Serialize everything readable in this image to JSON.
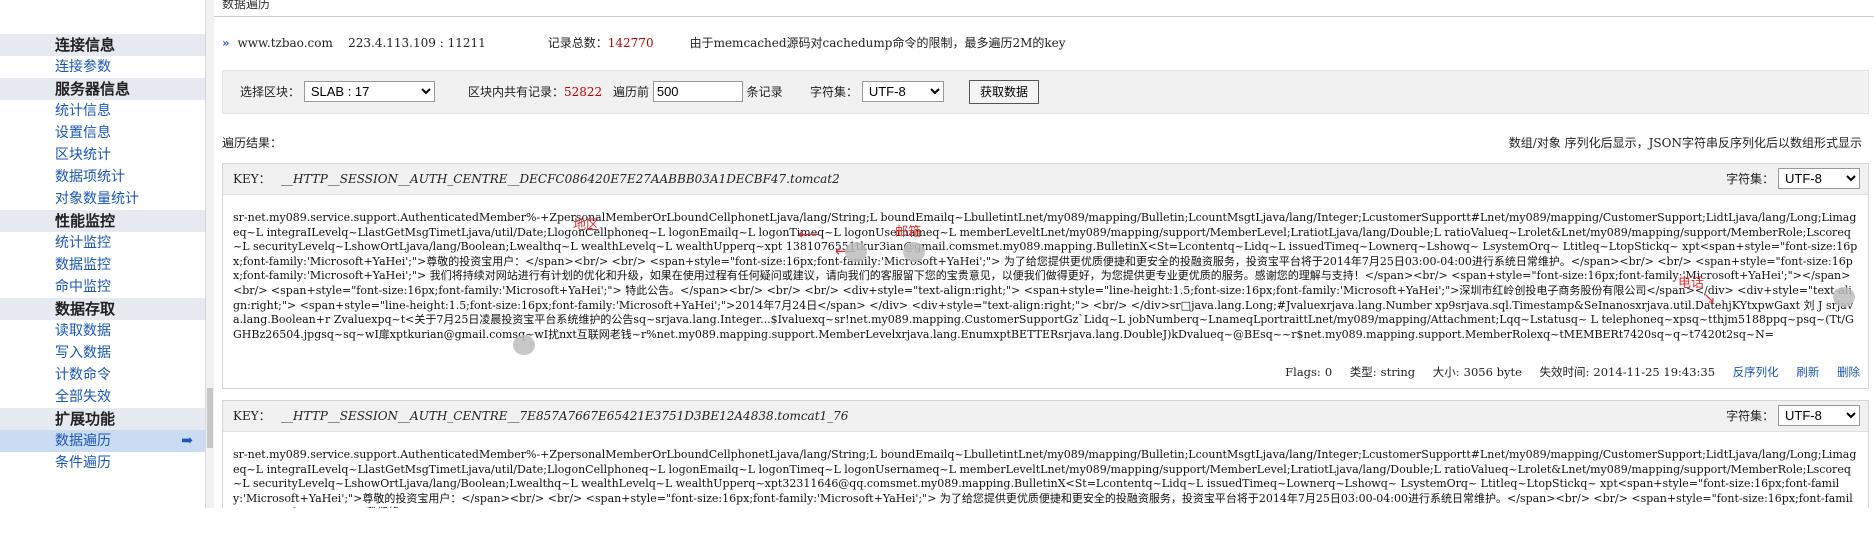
{
  "sidebar": {
    "groups": [
      {
        "title": "连接信息",
        "items": [
          {
            "label": "连接参数"
          }
        ]
      },
      {
        "title": "服务器信息",
        "items": [
          {
            "label": "统计信息"
          },
          {
            "label": "设置信息"
          },
          {
            "label": "区块统计"
          },
          {
            "label": "数据项统计"
          },
          {
            "label": "对象数量统计"
          }
        ]
      },
      {
        "title": "性能监控",
        "items": [
          {
            "label": "统计监控"
          },
          {
            "label": "数据监控"
          },
          {
            "label": "命中监控"
          }
        ]
      },
      {
        "title": "数据存取",
        "items": [
          {
            "label": "读取数据"
          },
          {
            "label": "写入数据"
          },
          {
            "label": "计数命令"
          },
          {
            "label": "全部失效"
          }
        ]
      },
      {
        "title": "扩展功能",
        "items": [
          {
            "label": "数据遍历",
            "active": true,
            "arrow": "➡"
          },
          {
            "label": "条件遍历"
          }
        ]
      }
    ]
  },
  "page": {
    "title": "数据遍历"
  },
  "info": {
    "icon": "»",
    "host": "www.tzbao.com",
    "address": "223.4.113.109 : 11211",
    "total_label": "记录总数：",
    "total_value": "142770",
    "note": "由于memcached源码对cachedump命令的限制，最多遍历2M的key"
  },
  "controls": {
    "slab_label": "选择区块：",
    "slab_value": "SLAB : 17",
    "slab_records_label": "区块内共有记录：",
    "slab_records_value": "52822",
    "traverse_label": "遍历前",
    "traverse_value": "500",
    "traverse_unit": "条记录",
    "charset_label": "字符集：",
    "charset_value": "UTF-8",
    "fetch_button": "获取数据"
  },
  "results": {
    "label": "遍历结果：",
    "note": "数组/对象 序列化后显示，JSON字符串反序列化后以数组形式显示"
  },
  "items": [
    {
      "key_label": "KEY：",
      "key": "__HTTP__SESSION__AUTH_CENTRE__DECFC086420E7E27AABBB03A1DECBF47.tomcat2",
      "charset_label": "字符集：",
      "charset": "UTF-8",
      "value": "sr-net.my089.service.support.AuthenticatedMember%-+ZpersonalMemberOrLboundCellphonetLjava/lang/String;L boundEmailq~LbulletintLnet/my089/mapping/Bulletin;LcountMsgtLjava/lang/Integer;LcustomerSupportt#Lnet/my089/mapping/CustomerSupport;LidtLjava/lang/Long;Limageq~L integraILevelq~LlastGetMsgTimetLjava/util/Date;LlogonCellphoneq~L logonEmailq~L logonTimeq~L logonUsernameq~L memberLeveltLnet/my089/mapping/support/MemberLevel;LratiotLjava/lang/Double;L ratioValueq~Lrolet&Lnet/my089/mapping/support/MemberRole;Lscoreq~L securityLevelq~LshowOrtLjava/lang/Boolean;Lwealthq~L wealthLevelq~L wealthUpperq~xpt 1381076551tkur3ian@gmail.comsmet.my089.mapping.BulletinX<St=Lcontentq~Lidq~L issuedTimeq~Lownerq~Lshowq~ LsystemOrq~ Ltitleq~LtopStickq~ xpt<span+style=\"font-size:16px;font-family:'Microsoft+YaHei';\">尊敬的投资宝用户：</span><br/> <br/> <span+style=\"font-size:16px;font-family:'Microsoft+YaHei';\">      为了给您提供更优质便捷和更安全的投融资服务，投资宝平台将于2014年7月25日03:00-04:00进行系统日常维护。</span><br/> <br/> <span+style=\"font-size:16px;font-family:'Microsoft+YaHei';\">      我们将持续对网站进行有计划的优化和升级，如果在使用过程有任何疑问或建议，请向我们的客服留下您的宝贵意见，以便我们做得更好，为您提供更专业更优质的服务。感谢您的理解与支持！</span><br/> <span+style=\"font-size:16px;font-family:'Microsoft+YaHei';\"></span><br/> <span+style=\"font-size:16px;font-family:'Microsoft+YaHei';\">      特此公告。</span><br/> <br/> <br/> <div+style=\"text-align:right;\"> <span+style=\"line-height:1.5;font-size:16px;font-family:'Microsoft+YaHei';\">深圳市红岭创投电子商务股份有限公司</span></div> <div+style=\"text-align:right;\"> <span+style=\"line-height:1.5;font-size:16px;font-family:'Microsoft+YaHei';\">2014年7月24日</span> </div> <div+style=\"text-align:right;\"> <br/> </div>sr□java.lang.Long;#Jvaluexrjava.lang.Number xp9srjava.sql.Timestamp&SeInanosxrjava.util.DatehjKYtxpwGaxt 刘 J srjava.lang.Boolean+r Zvaluexpq~t<关于7月25日凌晨投资宝平台系统维护的公告sq~srjava.lang.Integer...$Ivaluexq~sr!net.my089.mapping.CustomerSupportGz`Lidq~L jobNumberq~LnameqLportraittLnet/my089/mapping/Attachment;Lqq~Lstatusq~ L telephoneq~xpsq~tthjm5188ppq~psq~(Tt/GGHBz26504.jpgsq~sq~wI扉xptkurian@gmail.comsq~wI扰nxt互联网老钱~r%net.my089.mapping.support.MemberLevelxrjava.lang.EnumxptBETTERsrjava.lang.DoubleJ)kDvalueq~@BEsq~~r$net.my089.mapping.support.MemberRolexq~tMEMBERt7420sq~q~t7420t2sq~N=",
      "flags_label": "Flags:",
      "flags": "0",
      "type_label": "类型:",
      "type": "string",
      "size_label": "大小:",
      "size": "3056 byte",
      "expire_label": "失效时间:",
      "expire": "2014-11-25 19:43:35",
      "actions": [
        "反序列化",
        "刷新",
        "删除"
      ],
      "marks": [
        "地区",
        "邮箱",
        "电话"
      ]
    },
    {
      "key_label": "KEY：",
      "key": "__HTTP__SESSION__AUTH_CENTRE__7E857A7667E65421E3751D3BE12A4838.tomcat1_76",
      "charset_label": "字符集：",
      "charset": "UTF-8",
      "value": "sr-net.my089.service.support.AuthenticatedMember%-+ZpersonalMemberOrLboundCellphonetLjava/lang/String;L boundEmailq~LbulletintLnet/my089/mapping/Bulletin;LcountMsgtLjava/lang/Integer;LcustomerSupportt#Lnet/my089/mapping/CustomerSupport;LidtLjava/lang/Long;Limageq~L integraILevelq~LlastGetMsgTimetLjava/util/Date;LlogonCellphoneq~L logonEmailq~L logonTimeq~L logonUsernameq~L memberLeveltLnet/my089/mapping/support/MemberLevel;LratiotLjava/lang/Double;L ratioValueq~Lrolet&Lnet/my089/mapping/support/MemberRole;Lscoreq~L securityLevelq~LshowOrtLjava/lang/Boolean;Lwealthq~L wealthLevelq~L wealthUpperq~xpt32311646@qq.comsmet.my089.mapping.BulletinX<St=Lcontentq~Lidq~L issuedTimeq~Lownerq~Lshowq~ LsystemOrq~ Ltitleq~LtopStickq~ xpt<span+style=\"font-size:16px;font-family:'Microsoft+YaHei';\">尊敬的投资宝用户：</span><br/> <br/> <span+style=\"font-size:16px;font-family:'Microsoft+YaHei';\">      为了给您提供更优质便捷和更安全的投融资服务，投资宝平台将于2014年7月25日03:00-04:00进行系统日常维护。</span><br/> <br/> <span+style=\"font-size:16px;font-family:'Microsoft+YaHei';\">      我们将"
    }
  ]
}
